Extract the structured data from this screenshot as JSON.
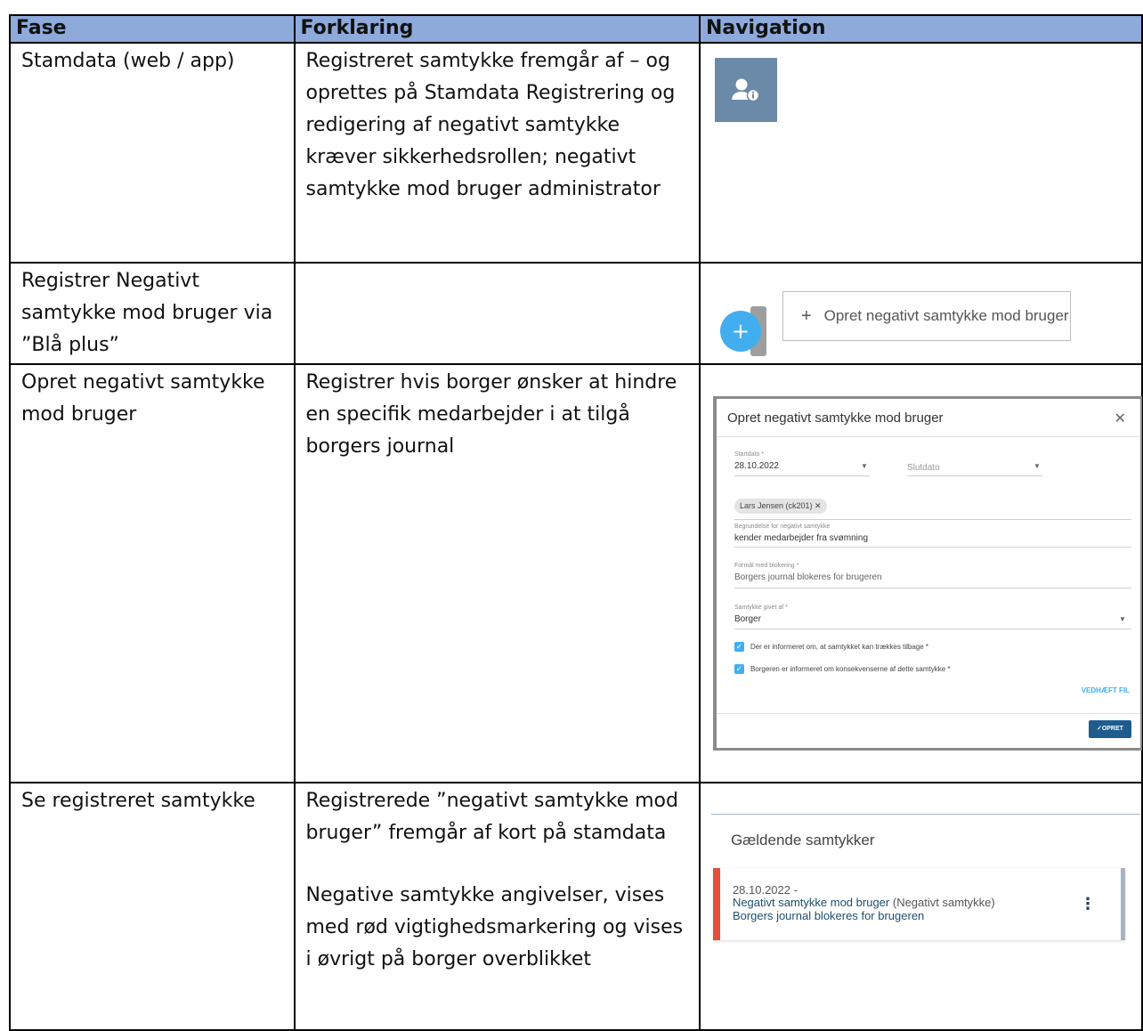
{
  "table": {
    "headers": [
      "Fase",
      "Forklaring",
      "Navigation"
    ],
    "rows": [
      {
        "fase": "Stamdata (web / app)",
        "forklaring": "Registreret samtykke fremgår af – og oprettes på Stamdata Registrering og redigering  af negativt samtykke kræver sikkerhedsrollen; negativt samtykke mod bruger administrator",
        "nav_icon": "user-info-icon"
      },
      {
        "fase": "Registrer Negativt samtykke mod bruger via ”Blå plus”",
        "forklaring": "",
        "nav_fab": "+",
        "nav_button_label": "Opret negativt samtykke mod bruger"
      },
      {
        "fase": "Opret negativt samtykke mod bruger",
        "forklaring": "Registrer hvis borger ønsker at hindre en specifik medarbejder i at tilgå borgers journal",
        "dialog": {
          "title": "Opret negativt samtykke mod bruger",
          "startdato_label": "Startdato *",
          "startdato_value": "28.10.2022",
          "slutdato_placeholder": "Slutdato",
          "chip": "Lars Jensen (ck201)",
          "begrundelse_label": "Begrundelse for negativt samtykke",
          "begrundelse_value": "kender medarbejder fra svømning",
          "formaal_label": "Formål med blokering *",
          "formaal_value": "Borgers journal blokeres for brugeren",
          "givet_label": "Samtykke givet af *",
          "givet_value": "Borger",
          "check1": "Der er informeret om, at samtykket kan trækkes tilbage *",
          "check2": "Borgeren er informeret om konsekvenserne af dette samtykke *",
          "attach_label": "VEDHÆFT FIL",
          "submit_label": "OPRET"
        }
      },
      {
        "fase": "Se registreret samtykke",
        "forklaring_1": "Registrerede ”negativt samtykke mod bruger” fremgår af kort på stamdata",
        "forklaring_2": "Negative samtykke angivelser, vises med rød vigtighedsmarkering og vises i øvrigt på borger overblikket",
        "card": {
          "title": "Gældende samtykker",
          "date": "28.10.2022 -",
          "name": "Negativt samtykke mod bruger",
          "type": "(Negativt samtykke)",
          "desc": "Borgers journal blokeres for brugeren"
        }
      }
    ]
  },
  "colors": {
    "header_bg": "#8eaadb",
    "fab_blue": "#42aef0",
    "important_red": "#e74c3c",
    "icon_tile": "#6b8aa8"
  }
}
